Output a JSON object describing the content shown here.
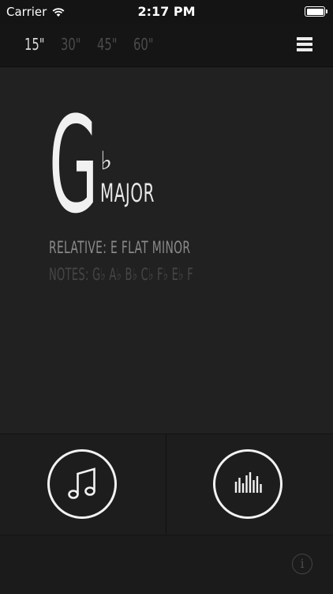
{
  "status_bar": {
    "carrier": "Carrier",
    "time": "2:17 PM"
  },
  "durations": [
    "15\"",
    "30\"",
    "45\"",
    "60\""
  ],
  "selected_duration": "15\"",
  "key": {
    "letter": "G",
    "accidental": "♭",
    "mode": "MAJOR",
    "relative": "RELATIVE: E FLAT MINOR",
    "notes": "NOTES: G♭ A♭ B♭ C♭ F♭ E♭ F"
  },
  "icons": {
    "wifi": "wifi-icon",
    "battery": "battery-icon",
    "menu": "menu-icon",
    "play_notes": "music-notes-icon",
    "sound_bars": "equalizer-icon",
    "info": "info-icon"
  },
  "info_label": "i",
  "colors": {
    "background": "#212121",
    "top_bar": "#151515",
    "active_duration": "#d8d8d8",
    "inactive_duration": "#4a4a4a"
  }
}
